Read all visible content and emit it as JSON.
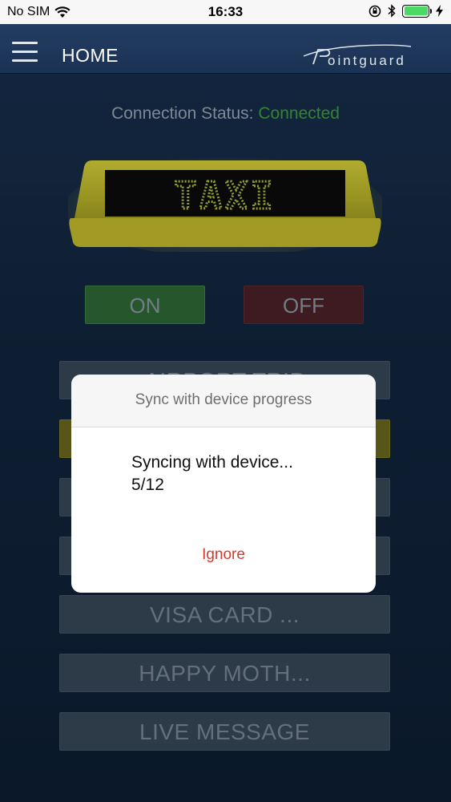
{
  "status_bar": {
    "carrier": "No SIM",
    "time": "16:33"
  },
  "nav": {
    "title": "HOME",
    "brand": "ointguard"
  },
  "connection": {
    "label": "Connection Status:",
    "value": "Connected"
  },
  "taxi_sign": {
    "text": "TAXI"
  },
  "toggle": {
    "on_label": "ON",
    "off_label": "OFF"
  },
  "list": [
    {
      "label": "AIRPORT TRIP"
    },
    {
      "label": ""
    },
    {
      "label": ""
    },
    {
      "label": ""
    },
    {
      "label": "VISA CARD ..."
    },
    {
      "label": "HAPPY MOTH..."
    },
    {
      "label": "LIVE MESSAGE"
    }
  ],
  "dialog": {
    "title": "Sync with device progress",
    "message_line1": "Syncing with device...",
    "message_line2": "5/12",
    "ignore_label": "Ignore"
  },
  "colors": {
    "connected": "#3fa13b",
    "ignore": "#d83a2b",
    "taxi_body": "#c9c22a",
    "led": "#b3bf3a"
  },
  "icons": [
    "wifi-icon",
    "orientation-lock-icon",
    "bluetooth-icon",
    "battery-icon",
    "charging-icon",
    "hamburger-menu-icon"
  ]
}
